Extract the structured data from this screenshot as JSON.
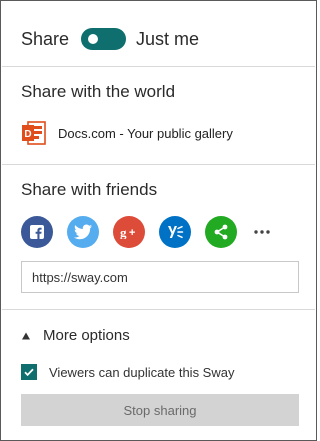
{
  "header": {
    "share_label": "Share",
    "toggle_state": "off",
    "just_me_label": "Just me"
  },
  "world": {
    "title": "Share with the world",
    "docs_label": "Docs.com - Your public gallery"
  },
  "friends": {
    "title": "Share with friends",
    "services": [
      {
        "name": "facebook",
        "glyph": "f",
        "color": "#3b5998"
      },
      {
        "name": "twitter",
        "glyph": "t",
        "color": "#55acee"
      },
      {
        "name": "google-plus",
        "glyph": "g+",
        "color": "#dd4b39"
      },
      {
        "name": "yammer",
        "glyph": "y",
        "color": "#0072c6"
      },
      {
        "name": "share",
        "glyph": "share",
        "color": "#22aa22"
      }
    ],
    "more_glyph": "•••",
    "url_value": "https://sway.com"
  },
  "options": {
    "more_options_label": "More options",
    "duplicate_label": "Viewers can duplicate this Sway",
    "duplicate_checked": true,
    "stop_sharing_label": "Stop sharing"
  },
  "colors": {
    "accent": "#0f6e6e",
    "docs_orange": "#e04e1c"
  }
}
